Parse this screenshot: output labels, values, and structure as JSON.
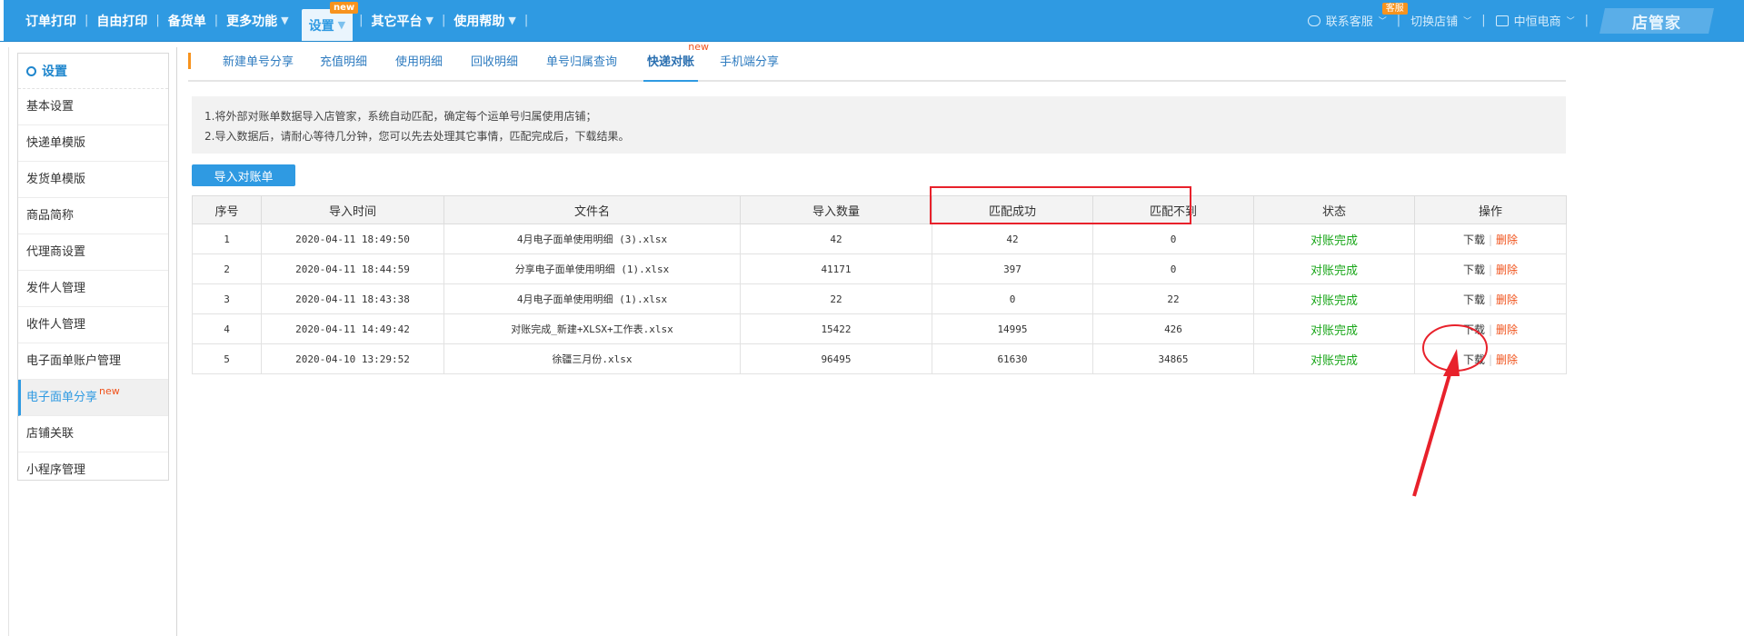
{
  "topnav": {
    "items": [
      {
        "label": "订单打印"
      },
      {
        "label": "自由打印"
      },
      {
        "label": "备货单"
      },
      {
        "label": "更多功能",
        "caret": "▼"
      },
      {
        "label": "设置",
        "caret": "▼",
        "badge": "new",
        "active": true
      },
      {
        "label": "其它平台",
        "caret": "▼"
      },
      {
        "label": "使用帮助",
        "caret": "▼"
      }
    ],
    "right": {
      "contact": "联系客服",
      "contact_badge": "客服",
      "switch_store": "切换店铺",
      "store_name": "中恒电商",
      "brand": "店管家"
    }
  },
  "sidebar": {
    "title": "设置",
    "items": [
      {
        "label": "基本设置"
      },
      {
        "label": "快递单模版"
      },
      {
        "label": "发货单模版"
      },
      {
        "label": "商品简称"
      },
      {
        "label": "代理商设置"
      },
      {
        "label": "发件人管理"
      },
      {
        "label": "收件人管理"
      },
      {
        "label": "电子面单账户管理"
      },
      {
        "label": "电子面单分享",
        "badge": "new",
        "active": true
      },
      {
        "label": "店铺关联"
      },
      {
        "label": "小程序管理"
      }
    ]
  },
  "tabs": [
    {
      "label": "新建单号分享"
    },
    {
      "label": "充值明细"
    },
    {
      "label": "使用明细"
    },
    {
      "label": "回收明细"
    },
    {
      "label": "单号归属查询"
    },
    {
      "label": "快递对账",
      "badge": "new",
      "active": true
    },
    {
      "label": "手机端分享"
    }
  ],
  "notice": {
    "line1": "1.将外部对账单数据导入店管家，系统自动匹配，确定每个运单号归属使用店铺；",
    "line2": "2.导入数据后，请耐心等待几分钟，您可以先去处理其它事情，匹配完成后，下载结果。"
  },
  "import_button": "导入对账单",
  "table": {
    "headers": [
      "序号",
      "导入时间",
      "文件名",
      "导入数量",
      "匹配成功",
      "匹配不到",
      "状态",
      "操作"
    ],
    "rows": [
      {
        "no": "1",
        "time": "2020-04-11 18:49:50",
        "file": "4月电子面单使用明细 (3).xlsx",
        "count": "42",
        "matched": "42",
        "unmatched": "0",
        "status": "对账完成",
        "download": "下载",
        "delete": "删除"
      },
      {
        "no": "2",
        "time": "2020-04-11 18:44:59",
        "file": "分享电子面单使用明细 (1).xlsx",
        "count": "41171",
        "matched": "397",
        "unmatched": "0",
        "status": "对账完成",
        "download": "下载",
        "delete": "删除"
      },
      {
        "no": "3",
        "time": "2020-04-11 18:43:38",
        "file": "4月电子面单使用明细 (1).xlsx",
        "count": "22",
        "matched": "0",
        "unmatched": "22",
        "status": "对账完成",
        "download": "下载",
        "delete": "删除"
      },
      {
        "no": "4",
        "time": "2020-04-11 14:49:42",
        "file": "对账完成_新建+XLSX+工作表.xlsx",
        "count": "15422",
        "matched": "14995",
        "unmatched": "426",
        "status": "对账完成",
        "download": "下载",
        "delete": "删除"
      },
      {
        "no": "5",
        "time": "2020-04-10 13:29:52",
        "file": "徐疆三月份.xlsx",
        "count": "96495",
        "matched": "61630",
        "unmatched": "34865",
        "status": "对账完成",
        "download": "下载",
        "delete": "删除"
      }
    ]
  },
  "colors": {
    "primary": "#2f9ae2",
    "badge_orange": "#f7931e",
    "status_green": "#19a619",
    "delete_red": "#f0521b",
    "annotation_red": "#e8212b"
  }
}
